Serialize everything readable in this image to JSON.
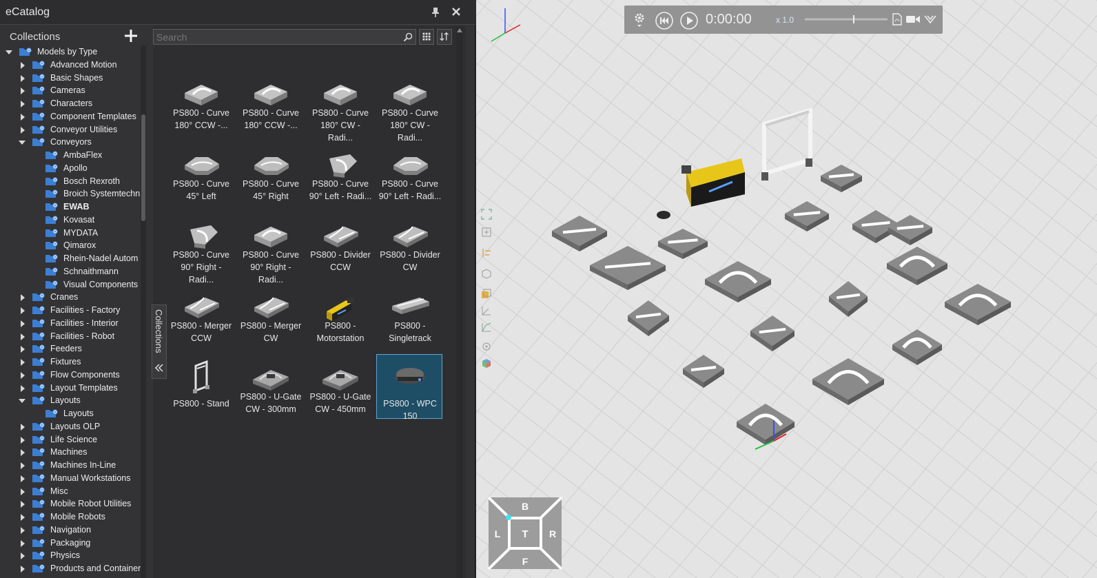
{
  "window": {
    "title": "eCatalog"
  },
  "collections": {
    "label": "Collections",
    "tree": [
      {
        "label": "Models by Type",
        "level": 0,
        "state": "expanded"
      },
      {
        "label": "Advanced Motion",
        "level": 1,
        "state": "collapsed"
      },
      {
        "label": "Basic Shapes",
        "level": 1,
        "state": "collapsed"
      },
      {
        "label": "Cameras",
        "level": 1,
        "state": "collapsed"
      },
      {
        "label": "Characters",
        "level": 1,
        "state": "collapsed"
      },
      {
        "label": "Component Templates",
        "level": 1,
        "state": "collapsed"
      },
      {
        "label": "Conveyor Utilities",
        "level": 1,
        "state": "collapsed"
      },
      {
        "label": "Conveyors",
        "level": 1,
        "state": "expanded"
      },
      {
        "label": "AmbaFlex",
        "level": 2,
        "state": "leaf"
      },
      {
        "label": "Apollo",
        "level": 2,
        "state": "leaf"
      },
      {
        "label": "Bosch Rexroth",
        "level": 2,
        "state": "leaf"
      },
      {
        "label": "Broich Systemtechn",
        "level": 2,
        "state": "leaf"
      },
      {
        "label": "EWAB",
        "level": 2,
        "state": "leaf",
        "bold": true
      },
      {
        "label": "Kovasat",
        "level": 2,
        "state": "leaf"
      },
      {
        "label": "MYDATA",
        "level": 2,
        "state": "leaf"
      },
      {
        "label": "Qimarox",
        "level": 2,
        "state": "leaf"
      },
      {
        "label": "Rhein-Nadel Autom",
        "level": 2,
        "state": "leaf"
      },
      {
        "label": "Schnaithmann",
        "level": 2,
        "state": "leaf"
      },
      {
        "label": "Visual Components",
        "level": 2,
        "state": "leaf"
      },
      {
        "label": "Cranes",
        "level": 1,
        "state": "collapsed"
      },
      {
        "label": "Facilities - Factory",
        "level": 1,
        "state": "collapsed"
      },
      {
        "label": "Facilities - Interior",
        "level": 1,
        "state": "collapsed"
      },
      {
        "label": "Facilities - Robot",
        "level": 1,
        "state": "collapsed"
      },
      {
        "label": "Feeders",
        "level": 1,
        "state": "collapsed"
      },
      {
        "label": "Fixtures",
        "level": 1,
        "state": "collapsed"
      },
      {
        "label": "Flow Components",
        "level": 1,
        "state": "collapsed"
      },
      {
        "label": "Layout Templates",
        "level": 1,
        "state": "collapsed"
      },
      {
        "label": "Layouts",
        "level": 1,
        "state": "expanded"
      },
      {
        "label": "Layouts",
        "level": 2,
        "state": "leaf"
      },
      {
        "label": "Layouts OLP",
        "level": 1,
        "state": "collapsed"
      },
      {
        "label": "Life Science",
        "level": 1,
        "state": "collapsed"
      },
      {
        "label": "Machines",
        "level": 1,
        "state": "collapsed"
      },
      {
        "label": "Machines In-Line",
        "level": 1,
        "state": "collapsed"
      },
      {
        "label": "Manual Workstations",
        "level": 1,
        "state": "collapsed"
      },
      {
        "label": "Misc",
        "level": 1,
        "state": "collapsed"
      },
      {
        "label": "Mobile Robot Utilities",
        "level": 1,
        "state": "collapsed"
      },
      {
        "label": "Mobile Robots",
        "level": 1,
        "state": "collapsed"
      },
      {
        "label": "Navigation",
        "level": 1,
        "state": "collapsed"
      },
      {
        "label": "Packaging",
        "level": 1,
        "state": "collapsed"
      },
      {
        "label": "Physics",
        "level": 1,
        "state": "collapsed"
      },
      {
        "label": "Products and Containers",
        "level": 1,
        "state": "collapsed"
      }
    ]
  },
  "search": {
    "placeholder": "Search",
    "value": ""
  },
  "collections_tab": {
    "label": "Collections"
  },
  "models": [
    {
      "line1": "PS800 - Curve",
      "line2": "180° CCW -...",
      "shape": "curve"
    },
    {
      "line1": "PS800 - Curve",
      "line2": "180° CCW -...",
      "shape": "curve"
    },
    {
      "line1": "PS800 - Curve",
      "line2": "180° CW - Radi...",
      "shape": "curve"
    },
    {
      "line1": "PS800 - Curve",
      "line2": "180° CW - Radi...",
      "shape": "curve"
    },
    {
      "line1": "PS800 - Curve",
      "line2": "45° Left",
      "shape": "flat"
    },
    {
      "line1": "PS800 - Curve",
      "line2": "45° Right",
      "shape": "flat"
    },
    {
      "line1": "PS800 - Curve",
      "line2": "90° Left - Radi...",
      "shape": "corner"
    },
    {
      "line1": "PS800 - Curve",
      "line2": "90° Left - Radi...",
      "shape": "flat"
    },
    {
      "line1": "PS800 - Curve",
      "line2": "90° Right - Radi...",
      "shape": "corner"
    },
    {
      "line1": "PS800 - Curve",
      "line2": "90° Right - Radi...",
      "shape": "curve"
    },
    {
      "line1": "PS800 - Divider",
      "line2": "CCW",
      "shape": "divider"
    },
    {
      "line1": "PS800 - Divider",
      "line2": "CW",
      "shape": "divider"
    },
    {
      "line1": "PS800 - Merger",
      "line2": "CCW",
      "shape": "divider"
    },
    {
      "line1": "PS800 - Merger",
      "line2": "CW",
      "shape": "divider"
    },
    {
      "line1": "PS800 -",
      "line2": "Motorstation",
      "shape": "motor"
    },
    {
      "line1": "PS800 -",
      "line2": "Singletrack",
      "shape": "track"
    },
    {
      "line1": "PS800 - Stand",
      "line2": "",
      "shape": "stand"
    },
    {
      "line1": "PS800 - U-Gate",
      "line2": "CW - 300mm",
      "shape": "ugate"
    },
    {
      "line1": "PS800 - U-Gate",
      "line2": "CW - 450mm",
      "shape": "ugate"
    },
    {
      "line1": "PS800 - WPC 150",
      "line2": "",
      "shape": "wpc",
      "selected": true
    }
  ],
  "playback": {
    "time": "0:00:00",
    "speed": "x 1.0"
  },
  "view_cube": {
    "top": "T",
    "back": "B",
    "front": "F",
    "left": "L",
    "right": "R"
  },
  "colors": {
    "accent": "#5fa6d0",
    "selected_tile": "#1e4d66",
    "folder": "#3b7fd4",
    "motor_yellow": "#e8c619"
  }
}
